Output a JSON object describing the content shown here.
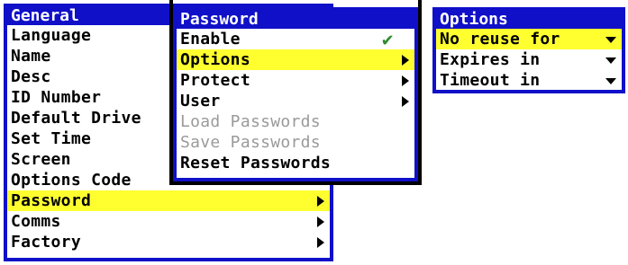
{
  "menus": {
    "general": {
      "title": "General",
      "items": [
        "Language",
        "Name",
        "Desc",
        "ID Number",
        "Default Drive",
        "Set Time",
        "Screen",
        "Options Code",
        "Password",
        "Comms",
        "Factory"
      ]
    },
    "password": {
      "title": "Password",
      "items": [
        "Enable",
        "Options",
        "Protect",
        "User",
        "Load Passwords",
        "Save Passwords",
        "Reset Passwords"
      ]
    },
    "options": {
      "title": "Options",
      "items": [
        "No reuse for",
        "Expires in",
        "Timeout in"
      ]
    }
  },
  "colors": {
    "menu_border": "#1010c8",
    "highlight": "#ffff30",
    "disabled_text": "#9a9a9a",
    "check": "#2e8b2e"
  },
  "icons": {
    "submenu": "submenu-arrow-icon",
    "dropdown": "dropdown-arrow-icon",
    "check": "checkmark-icon"
  }
}
